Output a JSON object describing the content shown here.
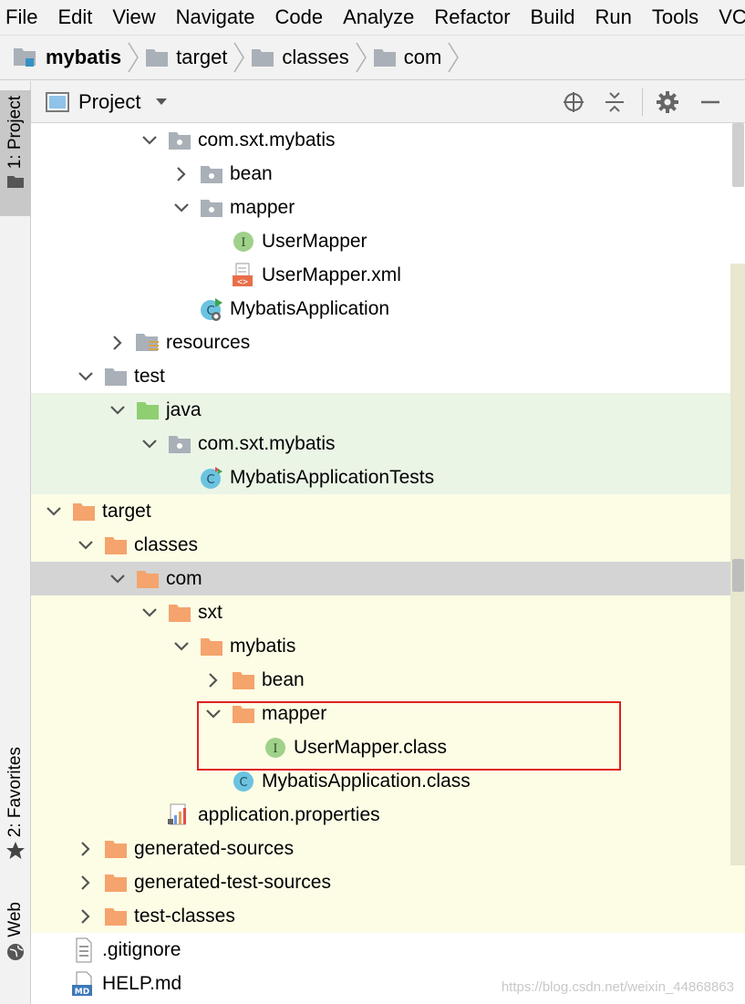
{
  "menu": [
    "File",
    "Edit",
    "View",
    "Navigate",
    "Code",
    "Analyze",
    "Refactor",
    "Build",
    "Run",
    "Tools",
    "VCS"
  ],
  "breadcrumb": [
    {
      "label": "mybatis",
      "icon": "module-folder-icon"
    },
    {
      "label": "target",
      "icon": "folder-icon"
    },
    {
      "label": "classes",
      "icon": "folder-icon"
    },
    {
      "label": "com",
      "icon": "folder-icon"
    }
  ],
  "left_strip": {
    "project_tab": "1: Project",
    "favorites_tab": "2: Favorites",
    "web_tab": "Web"
  },
  "panel": {
    "title": "Project"
  },
  "tree": [
    {
      "label": "com.sxt.mybatis",
      "expanded": true,
      "icon": "package-icon",
      "bg": "white"
    },
    {
      "label": "bean",
      "expanded": false,
      "icon": "package-icon",
      "bg": "white"
    },
    {
      "label": "mapper",
      "expanded": true,
      "icon": "package-icon",
      "bg": "white"
    },
    {
      "label": "UserMapper",
      "icon": "interface-icon",
      "bg": "white"
    },
    {
      "label": "UserMapper.xml",
      "icon": "xml-file-icon",
      "bg": "white"
    },
    {
      "label": "MybatisApplication",
      "icon": "spring-class-icon",
      "bg": "white"
    },
    {
      "label": "resources",
      "expanded": false,
      "icon": "resources-folder-icon",
      "bg": "white"
    },
    {
      "label": "test",
      "expanded": true,
      "icon": "folder-icon",
      "bg": "white"
    },
    {
      "label": "java",
      "expanded": true,
      "icon": "test-folder-icon",
      "bg": "green"
    },
    {
      "label": "com.sxt.mybatis",
      "expanded": true,
      "icon": "package-icon",
      "bg": "green"
    },
    {
      "label": "MybatisApplicationTests",
      "icon": "test-class-icon",
      "bg": "green"
    },
    {
      "label": "target",
      "expanded": true,
      "icon": "excluded-folder-icon",
      "bg": "yellow"
    },
    {
      "label": "classes",
      "expanded": true,
      "icon": "excluded-folder-icon",
      "bg": "yellow"
    },
    {
      "label": "com",
      "expanded": true,
      "icon": "excluded-folder-icon",
      "bg": "selected"
    },
    {
      "label": "sxt",
      "expanded": true,
      "icon": "excluded-folder-icon",
      "bg": "yellow"
    },
    {
      "label": "mybatis",
      "expanded": true,
      "icon": "excluded-folder-icon",
      "bg": "yellow"
    },
    {
      "label": "bean",
      "expanded": false,
      "icon": "excluded-folder-icon",
      "bg": "yellow"
    },
    {
      "label": "mapper",
      "expanded": true,
      "icon": "excluded-folder-icon",
      "bg": "yellow"
    },
    {
      "label": "UserMapper.class",
      "icon": "interface-icon",
      "bg": "yellow"
    },
    {
      "label": "MybatisApplication.class",
      "icon": "class-icon",
      "bg": "yellow"
    },
    {
      "label": "application.properties",
      "icon": "properties-file-icon",
      "bg": "yellow"
    },
    {
      "label": "generated-sources",
      "expanded": false,
      "icon": "excluded-folder-icon",
      "bg": "yellow"
    },
    {
      "label": "generated-test-sources",
      "expanded": false,
      "icon": "excluded-folder-icon",
      "bg": "yellow"
    },
    {
      "label": "test-classes",
      "expanded": false,
      "icon": "excluded-folder-icon",
      "bg": "yellow"
    },
    {
      "label": ".gitignore",
      "icon": "text-file-icon",
      "bg": "white"
    },
    {
      "label": "HELP.md",
      "icon": "markdown-file-icon",
      "bg": "white"
    }
  ],
  "watermark": "https://blog.csdn.net/weixin_44868863",
  "colors": {
    "excluded_folder": "#f4a46c",
    "package": "#a9b0b8",
    "test_bg": "#eaf5e6",
    "excluded_bg": "#fdfde6",
    "highlight_box": "#e02020"
  }
}
